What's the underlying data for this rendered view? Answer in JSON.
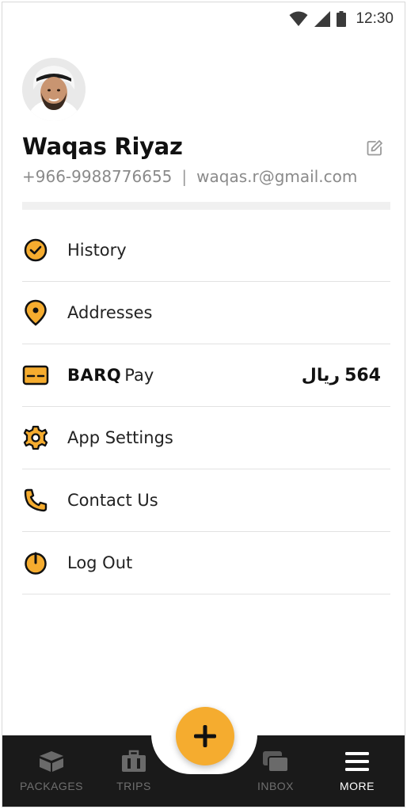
{
  "status_bar": {
    "time": "12:30"
  },
  "profile": {
    "name": "Waqas Riyaz",
    "phone": "+966-9988776655",
    "separator": "|",
    "email": "waqas.r@gmail.com"
  },
  "menu": [
    {
      "label": "History",
      "icon": "clock-check-icon"
    },
    {
      "label": "Addresses",
      "icon": "location-pin-icon"
    },
    {
      "label_brand": "BARQ",
      "label_suffix": "Pay",
      "icon": "wallet-card-icon",
      "currency": "ريال",
      "amount": "564"
    },
    {
      "label": "App Settings",
      "icon": "gear-icon"
    },
    {
      "label": "Contact Us",
      "icon": "phone-icon"
    },
    {
      "label": "Log Out",
      "icon": "power-icon"
    }
  ],
  "bottom_nav": {
    "items": [
      {
        "label": "PACKAGES",
        "icon": "packages-icon"
      },
      {
        "label": "TRIPS",
        "icon": "suitcase-icon"
      },
      {
        "label": "INBOX",
        "icon": "inbox-icon"
      },
      {
        "label": "MORE",
        "icon": "menu-icon",
        "active": true
      }
    ],
    "fab_icon": "plus-icon"
  },
  "colors": {
    "accent": "#F5AC2F",
    "nav_bg": "#1A1A1A",
    "icon_stroke": "#111111"
  }
}
